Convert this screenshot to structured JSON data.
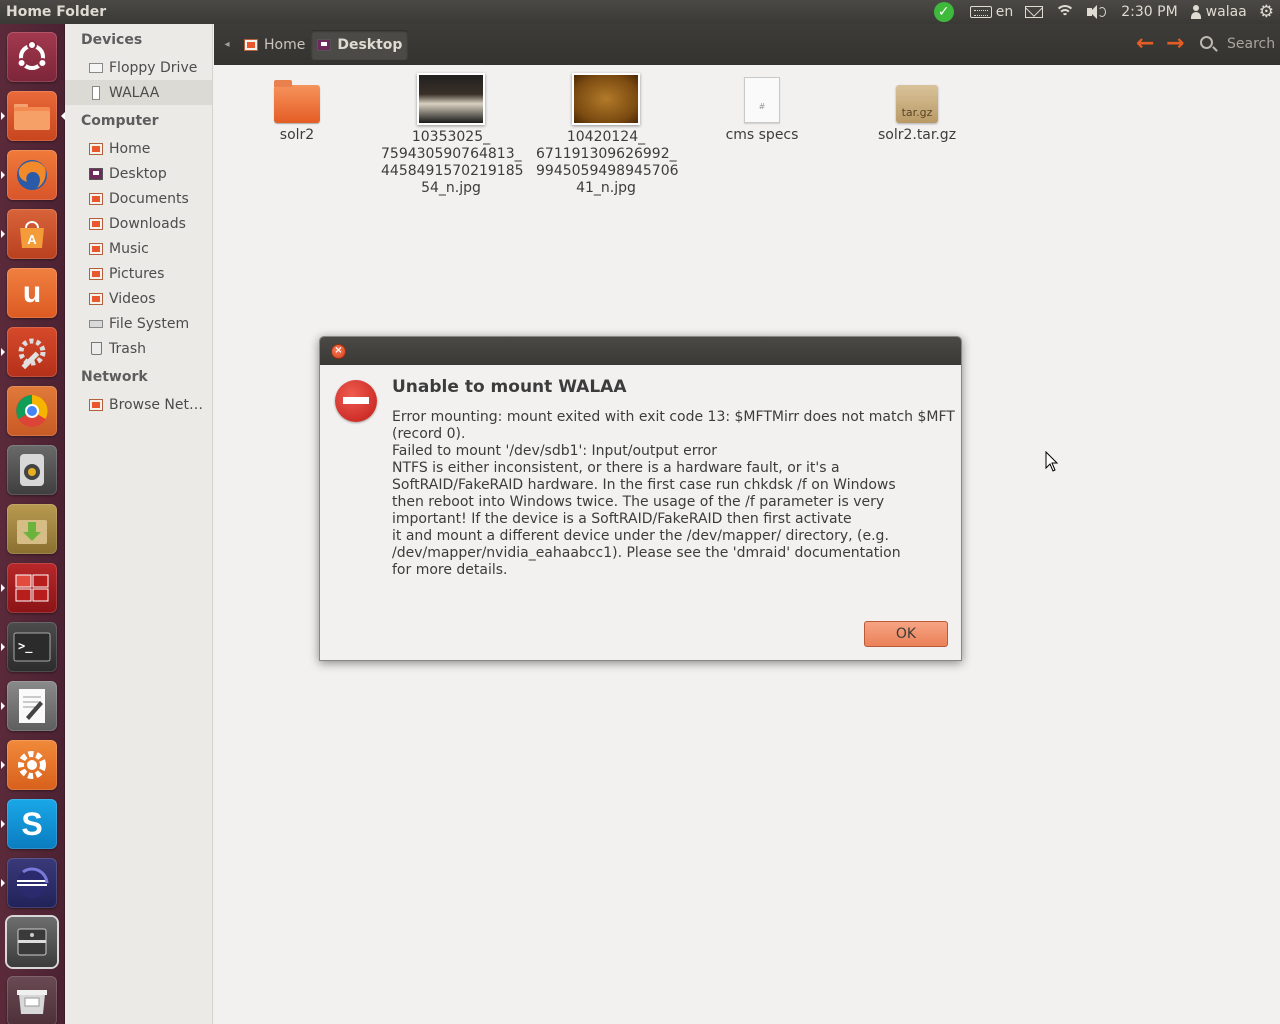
{
  "window": {
    "title": "Home Folder"
  },
  "top_panel": {
    "keyboard_layout": "en",
    "time": "2:30 PM",
    "user": "walaa"
  },
  "launcher": {
    "items": [
      {
        "name": "dash-icon"
      },
      {
        "name": "files-icon"
      },
      {
        "name": "firefox-icon"
      },
      {
        "name": "software-center-icon"
      },
      {
        "name": "ubuntu-one-icon"
      },
      {
        "name": "system-tools-icon"
      },
      {
        "name": "chrome-icon"
      },
      {
        "name": "audio-player-icon"
      },
      {
        "name": "archive-manager-icon"
      },
      {
        "name": "workspace-switcher-icon"
      },
      {
        "name": "terminal-icon"
      },
      {
        "name": "text-editor-icon"
      },
      {
        "name": "settings-icon"
      },
      {
        "name": "skype-icon"
      },
      {
        "name": "eclipse-icon"
      },
      {
        "name": "drive-icon"
      },
      {
        "name": "trash-icon"
      }
    ]
  },
  "sidebar": {
    "devices_header": "Devices",
    "devices": [
      {
        "label": "Floppy Drive",
        "icon": "floppy-icon"
      },
      {
        "label": "WALAA",
        "icon": "usb-drive-icon",
        "selected": true
      }
    ],
    "computer_header": "Computer",
    "computer": [
      {
        "label": "Home",
        "icon": "home-folder-icon"
      },
      {
        "label": "Desktop",
        "icon": "desktop-folder-icon"
      },
      {
        "label": "Documents",
        "icon": "documents-folder-icon"
      },
      {
        "label": "Downloads",
        "icon": "downloads-folder-icon"
      },
      {
        "label": "Music",
        "icon": "music-folder-icon"
      },
      {
        "label": "Pictures",
        "icon": "pictures-folder-icon"
      },
      {
        "label": "Videos",
        "icon": "videos-folder-icon"
      },
      {
        "label": "File System",
        "icon": "filesystem-icon"
      },
      {
        "label": "Trash",
        "icon": "trash-icon"
      }
    ],
    "network_header": "Network",
    "network": [
      {
        "label": "Browse Net…",
        "icon": "network-folder-icon"
      }
    ]
  },
  "toolbar": {
    "breadcrumbs": [
      {
        "label": "Home"
      },
      {
        "label": "Desktop",
        "active": true
      }
    ],
    "search_label": "Search"
  },
  "files": [
    {
      "name": "solr2",
      "type": "folder"
    },
    {
      "name": [
        "10353025_",
        "759430590764813_",
        "4458491570219185",
        "54_n.jpg"
      ],
      "type": "image"
    },
    {
      "name": [
        "10420124_",
        "671191309626992_",
        "9945059498945706",
        "41_n.jpg"
      ],
      "type": "image"
    },
    {
      "name": "cms specs",
      "type": "document"
    },
    {
      "name": "solr2.tar.gz",
      "type": "archive",
      "icon_text": "tar.gz"
    }
  ],
  "dialog": {
    "title": "Unable to mount WALAA",
    "message_lines": [
      "Error mounting: mount exited with exit code 13: $MFTMirr does not match $MFT",
      "(record 0).",
      "Failed to mount '/dev/sdb1': Input/output error",
      "NTFS is either inconsistent, or there is a hardware fault, or it's a",
      "SoftRAID/FakeRAID hardware. In the first case run chkdsk /f on Windows",
      "then reboot into Windows twice. The usage of the /f parameter is very",
      "important! If the device is a SoftRAID/FakeRAID then first activate",
      "it and mount a different device under the /dev/mapper/ directory, (e.g.",
      "/dev/mapper/nvidia_eahaabcc1). Please see the 'dmraid' documentation",
      "for more details."
    ],
    "ok_label": "OK"
  },
  "colors": {
    "accent": "#e45d25",
    "launcher_bg": "#5a2a3a",
    "panel_bg": "#3c3b37",
    "error_red": "#c01d18"
  }
}
